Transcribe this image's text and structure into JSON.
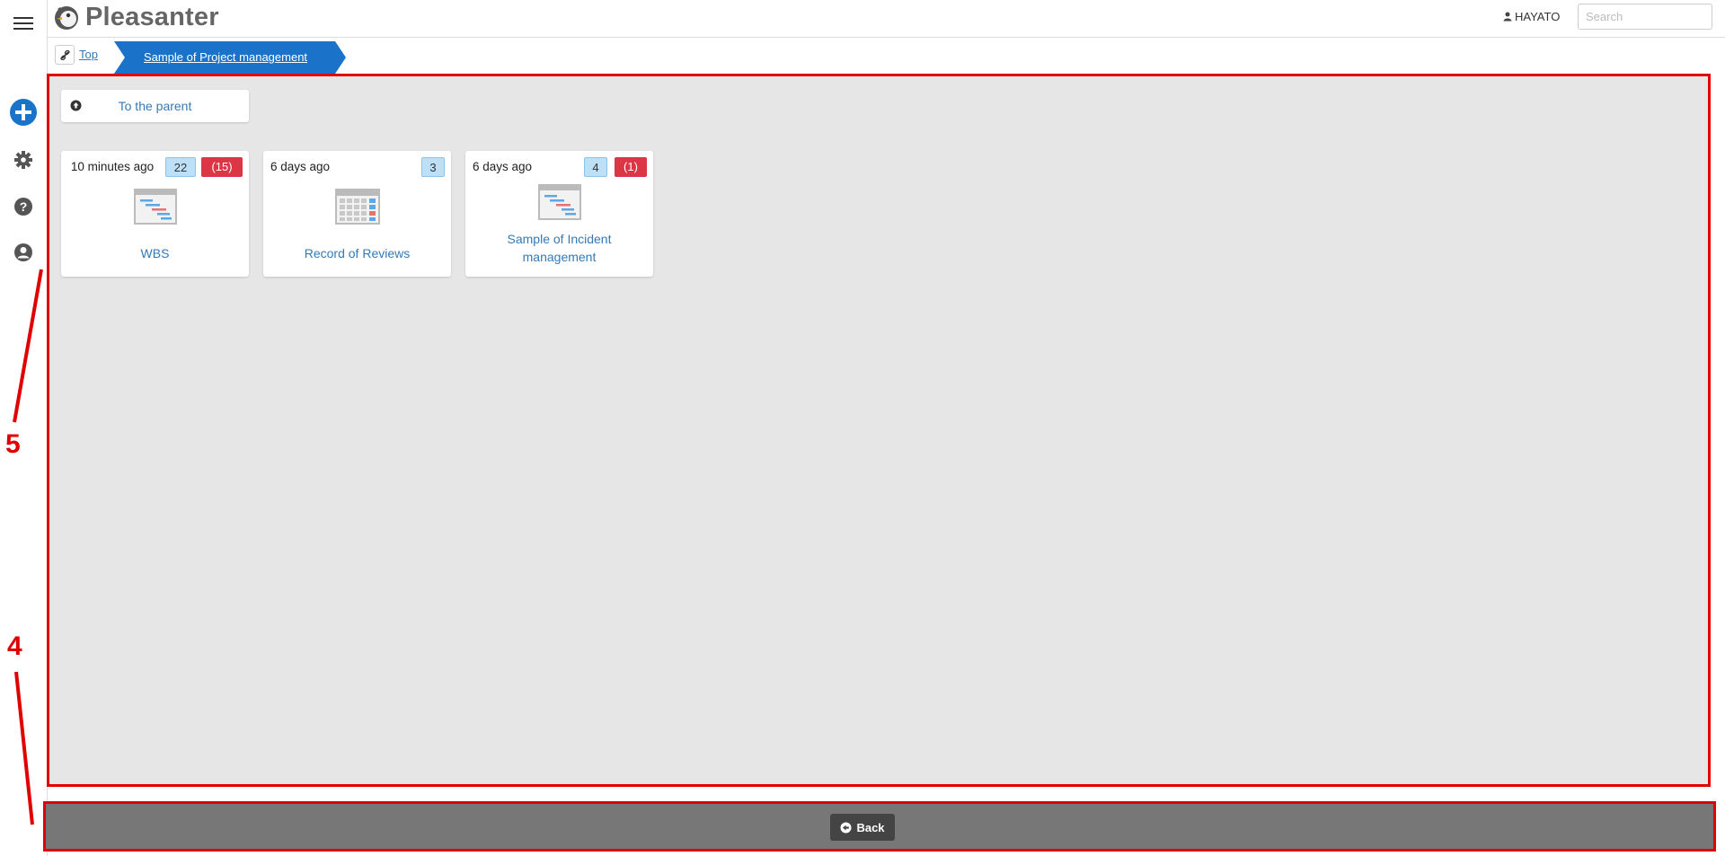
{
  "app": {
    "title": "Pleasanter"
  },
  "header": {
    "user_name": "HAYATO",
    "search_placeholder": "Search"
  },
  "rail": {
    "icons": [
      "menu-icon",
      "plus-circle-icon",
      "gear-icon",
      "question-circle-icon",
      "user-circle-icon"
    ]
  },
  "breadcrumb": {
    "top_label": "Top",
    "current_label": "Sample of Project management"
  },
  "main": {
    "parent_button_label": "To the parent",
    "tiles": [
      {
        "time": "10 minutes ago",
        "count": "22",
        "overdue": "(15)",
        "name": "WBS",
        "icon": "gantt-icon"
      },
      {
        "time": "6 days ago",
        "count": "3",
        "name": "Record of Reviews",
        "icon": "calendar-grid-icon"
      },
      {
        "time": "6 days ago",
        "count": "4",
        "overdue": "(1)",
        "name": "Sample of Incident management",
        "icon": "gantt-icon"
      }
    ]
  },
  "footer": {
    "back_label": "Back"
  },
  "annotations": {
    "label_5": "5",
    "label_4": "4"
  },
  "colors": {
    "accent_blue": "#1a73c9",
    "link_blue": "#337ab7",
    "badge_red": "#dc3545",
    "badge_blue": "#bde0f7",
    "annotation_red": "#e00000"
  }
}
